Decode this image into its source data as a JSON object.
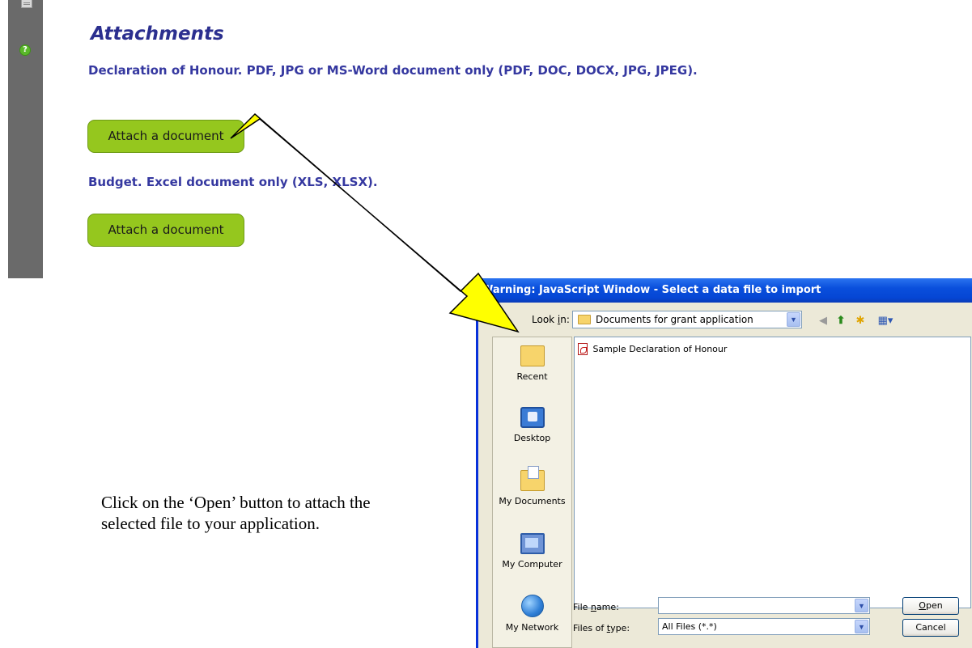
{
  "page": {
    "section_title": "Attachments",
    "fields": [
      {
        "label": "Declaration of Honour. PDF, JPG or MS-Word document only (PDF, DOC, DOCX, JPG, JPEG).",
        "button": "Attach a document"
      },
      {
        "label": "Budget. Excel document only (XLS, XLSX).",
        "button": "Attach a document"
      }
    ],
    "instruction": "Click on the ‘Open’ button to attach the selected file to your application.",
    "help_glyph": "?"
  },
  "dialog": {
    "title": "Warning: JavaScript Window - Select a data file to import",
    "look_in_label": "Look in:",
    "look_in_value": "Documents for grant application",
    "places": [
      {
        "label": "Recent",
        "icon": "recent-folder-icon"
      },
      {
        "label": "Desktop",
        "icon": "desktop-icon"
      },
      {
        "label": "My Documents",
        "icon": "my-documents-icon"
      },
      {
        "label": "My Computer",
        "icon": "my-computer-icon"
      },
      {
        "label": "My Network",
        "icon": "my-network-icon"
      }
    ],
    "files": [
      {
        "name": "Sample Declaration of Honour",
        "icon": "pdf-file-icon"
      }
    ],
    "file_name_label": "File name:",
    "file_name_value": "",
    "files_of_type_label": "Files of type:",
    "files_of_type_value": "All Files (*.*)",
    "open_button": "Open",
    "cancel_button": "Cancel"
  },
  "colors": {
    "heading": "#2b2f8f",
    "attach_button": "#95c71e",
    "arrow_fill": "#ffff00",
    "dialog_title_bar": "#0a4fdc"
  }
}
